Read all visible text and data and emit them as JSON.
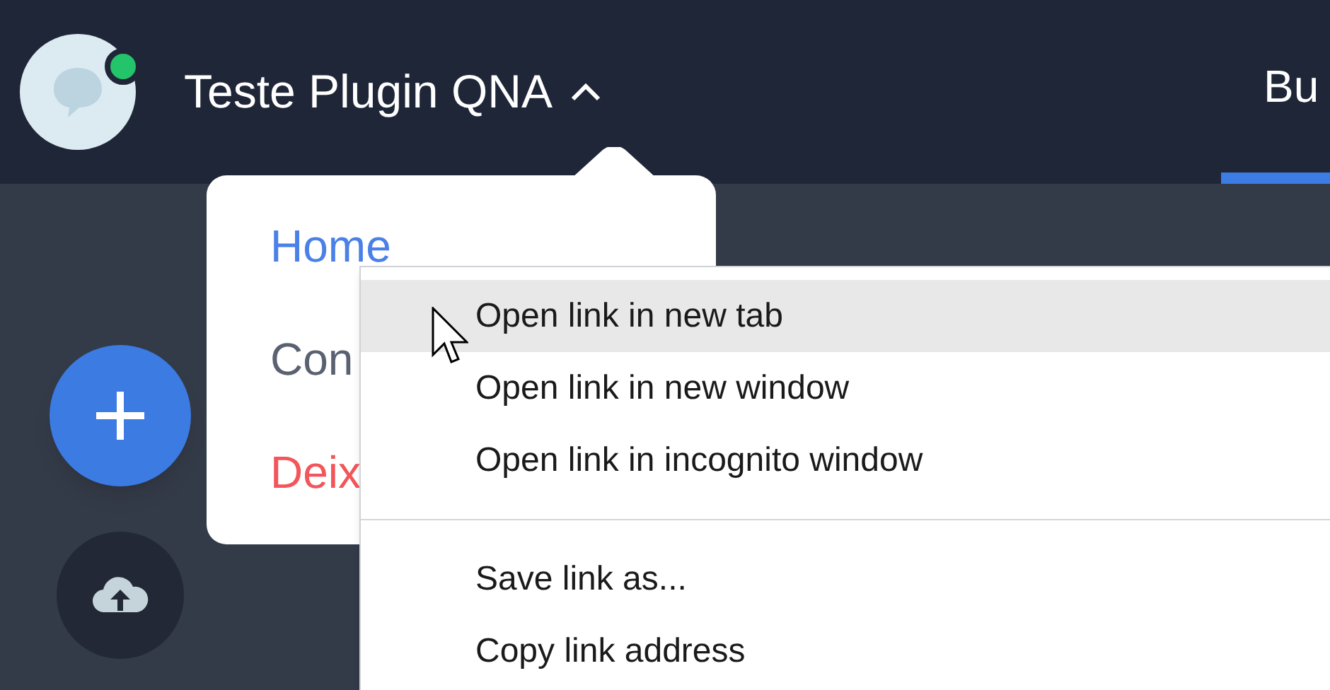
{
  "header": {
    "avatar": {
      "online": true
    },
    "title": "Teste Plugin QNA",
    "menu_expanded": true,
    "tabs": [
      {
        "label": "Bu",
        "selected": true
      }
    ]
  },
  "dropdown_menu": {
    "items": [
      {
        "label": "Home",
        "kind": "link"
      },
      {
        "label": "Con",
        "kind": "normal"
      },
      {
        "label": "Deix",
        "kind": "danger"
      }
    ]
  },
  "context_menu": {
    "groups": [
      [
        {
          "label": "Open link in new tab",
          "highlighted": true
        },
        {
          "label": "Open link in new window",
          "highlighted": false
        },
        {
          "label": "Open link in incognito window",
          "highlighted": false
        }
      ],
      [
        {
          "label": "Save link as...",
          "highlighted": false
        },
        {
          "label": "Copy link address",
          "highlighted": false
        }
      ]
    ]
  }
}
